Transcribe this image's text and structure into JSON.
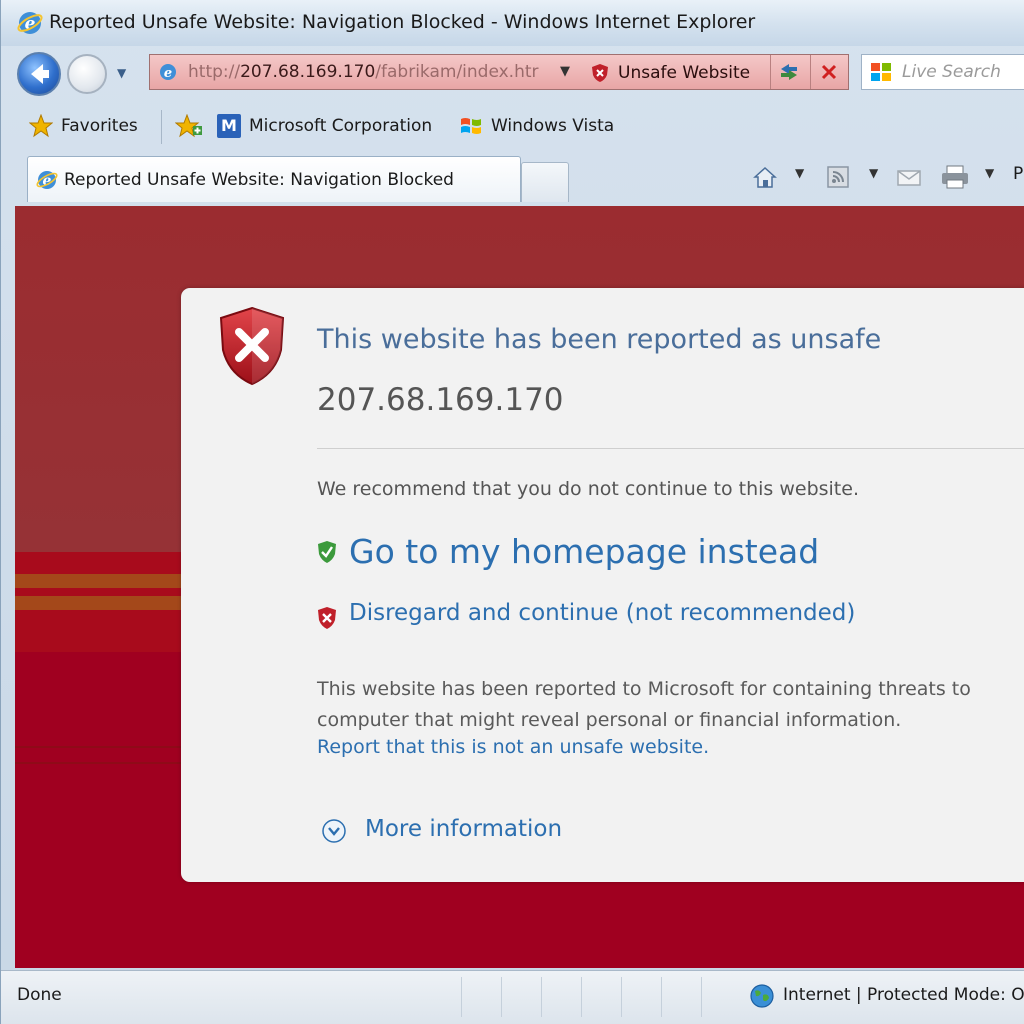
{
  "window": {
    "title": "Reported Unsafe Website: Navigation Blocked - Windows Internet Explorer"
  },
  "address_bar": {
    "url_prefix": "http://",
    "url_host": "207.68.169.170",
    "url_path": "/fabrikam/index.htr",
    "status_label": "Unsafe Website"
  },
  "search": {
    "placeholder": "Live Search"
  },
  "favorites_bar": {
    "favorites_label": "Favorites",
    "links": [
      "Microsoft Corporation",
      "Windows Vista"
    ]
  },
  "tab": {
    "label": "Reported Unsafe Website: Navigation Blocked"
  },
  "command_bar": {
    "page_initial": "P"
  },
  "warning": {
    "headline": "This website has been reported as unsafe",
    "address": "207.68.169.170",
    "recommendation": "We recommend that you do not continue to this website.",
    "homepage_link": "Go to my homepage instead",
    "continue_link": "Disregard and continue (not recommended)",
    "description_line1": "This website has been reported to Microsoft for containing threats to",
    "description_line2": "computer that might reveal personal or financial information.",
    "report_link": "Report that this is not an unsafe website.",
    "more_info": "More information"
  },
  "status_bar": {
    "status": "Done",
    "zone": "Internet | Protected Mode: O"
  },
  "colors": {
    "page_background": "#a00020",
    "link": "#2c6fb0",
    "headline": "#4a6e9a",
    "address_bar_alert": "#e8a6a6"
  }
}
